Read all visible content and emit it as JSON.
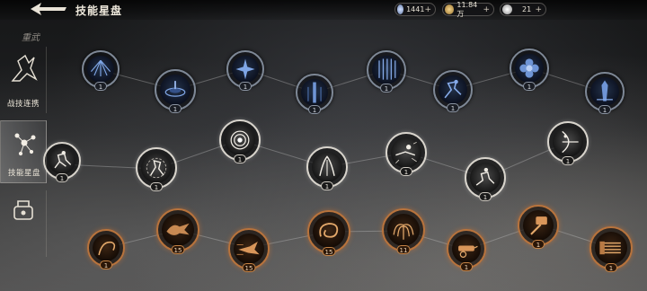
{
  "header": {
    "title": "技能星盘",
    "resources": [
      {
        "icon": "crystal-icon",
        "value": "1441",
        "plus": "+"
      },
      {
        "icon": "coin-icon",
        "value": "11.84万",
        "plus": "+"
      },
      {
        "icon": "token-icon",
        "value": "21",
        "plus": "+"
      }
    ]
  },
  "sidebar": {
    "category": "重武",
    "items": [
      {
        "label": "战技连携"
      },
      {
        "label": "技能星盘"
      },
      {
        "label": ""
      }
    ]
  },
  "nodes": {
    "row1": [
      {
        "icon": "light-rays-icon",
        "level": "1"
      },
      {
        "icon": "ground-slam-icon",
        "level": "1"
      },
      {
        "icon": "star-burst-icon",
        "level": "1"
      },
      {
        "icon": "light-pillar-icon",
        "level": "1"
      },
      {
        "icon": "sword-rain-icon",
        "level": "1"
      },
      {
        "icon": "leaping-strike-icon",
        "level": "1"
      },
      {
        "icon": "blossom-icon",
        "level": "1"
      },
      {
        "icon": "stake-icon",
        "level": "1"
      }
    ],
    "row2": [
      {
        "icon": "crouching-warrior-icon",
        "level": "1"
      },
      {
        "icon": "spinning-warrior-icon",
        "level": "1"
      },
      {
        "icon": "vortex-icon",
        "level": "1"
      },
      {
        "icon": "twin-slash-icon",
        "level": "1"
      },
      {
        "icon": "shockwave-icon",
        "level": "1"
      },
      {
        "icon": "kneeling-warrior-icon",
        "level": "1"
      },
      {
        "icon": "bow-draw-icon",
        "level": "1"
      }
    ],
    "row3": [
      {
        "icon": "whip-icon",
        "level": "1"
      },
      {
        "icon": "winged-charge-icon",
        "level": "15"
      },
      {
        "icon": "dash-strike-icon",
        "level": "15"
      },
      {
        "icon": "spiral-slash-icon",
        "level": "15"
      },
      {
        "icon": "fountain-icon",
        "level": "11"
      },
      {
        "icon": "cannon-icon",
        "level": "1"
      },
      {
        "icon": "hammer-icon",
        "level": "1"
      },
      {
        "icon": "brush-sweep-icon",
        "level": "1"
      }
    ]
  },
  "colors": {
    "blue_ring": "#7e8896",
    "white_ring": "#d8d4cc",
    "orange_ring": "#b8733c"
  }
}
